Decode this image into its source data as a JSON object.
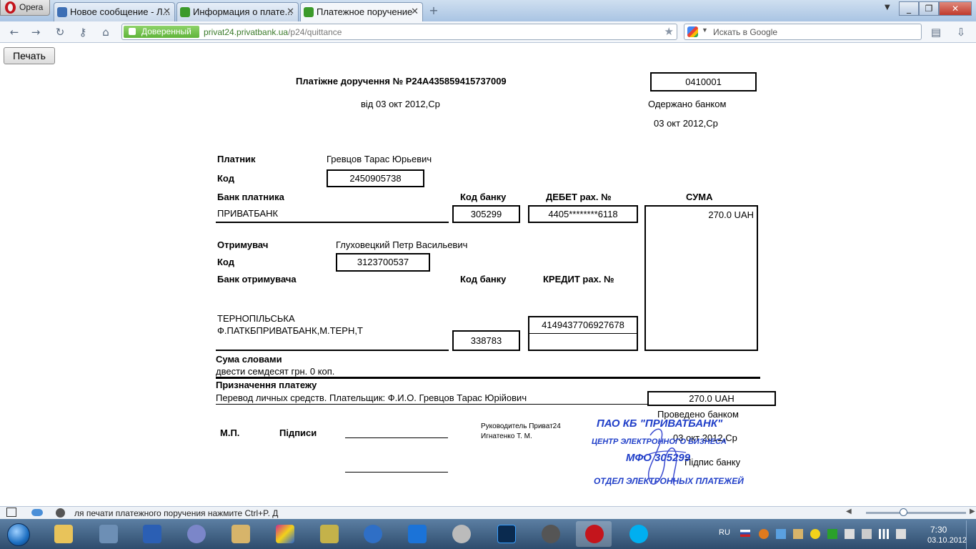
{
  "browser": {
    "app_button": "Opera",
    "tabs": [
      {
        "label": "Новое сообщение - Л...",
        "icon": "mail-icon"
      },
      {
        "label": "Информация о плате...",
        "icon": "privatbank-icon"
      },
      {
        "label": "Платежное поручение",
        "icon": "privatbank-icon"
      }
    ],
    "new_tab": "+",
    "trusted_label": "Доверенный",
    "url_host": "privat24.privatbank.ua",
    "url_path": "/p24/quittance",
    "search_placeholder": "Искать в Google",
    "window_controls": [
      "_",
      "❐",
      "✕"
    ]
  },
  "page": {
    "print_button": "Печать",
    "doc_title": "Платіжне доручення  № P24A435859415737009",
    "doc_date": "від 03 окт 2012,Ср",
    "form_code": "0410001",
    "received_label": "Одержано банком",
    "received_date": "03 окт 2012,Ср",
    "payer_label": "Платник",
    "payer_name": "Гревцов Тарас Юрьевич",
    "code_label": "Код",
    "payer_code": "2450905738",
    "payer_bank_label": "Банк платника",
    "bank_code_label": "Код банку",
    "debit_label": "ДЕБЕТ рах. №",
    "sum_label": "СУМА",
    "payer_bank": "ПРИВАТБАНК",
    "payer_bank_code": "305299",
    "debit_account": "4405********6118",
    "sum_value": "270.0 UAH",
    "recipient_label": "Отримувач",
    "recipient_name": "Глуховецкий Петр Васильевич",
    "recipient_code": "3123700537",
    "recipient_bank_label": "Банк отримувача",
    "credit_label": "КРЕДИТ рах. №",
    "recipient_bank_line1": "ТЕРНОПІЛЬСЬКА",
    "recipient_bank_line2": "Ф.ПАТКБПРИВАТБАНК,М.ТЕРН,Т",
    "credit_account": "4149437706927678",
    "recipient_bank_code": "338783",
    "sum_words_label": "Сума словами",
    "sum_words": "двести семдесят грн. 0 коп.",
    "purpose_label": "Призначення платежу",
    "purpose": "Перевод личных средств. Плательщик: Ф.И.О. Гревцов Тарас Юрійович",
    "purpose_sum": "270.0 UAH",
    "processed_label": "Проведено банком",
    "processed_date": "03 окт 2012,Ср",
    "bank_signature_label": "Підпис банку",
    "mp_label": "М.П.",
    "signatures_label": "Підписи",
    "manager_line1": "Руководитель Приват24",
    "manager_line2": "Игнатенко Т. М.",
    "stamp": {
      "line1": "ПАО КБ \"ПРИВАТБАНК\"",
      "line2": "ЦЕНТР ЭЛЕКТРОННОГО БИЗНЕСА",
      "line3": "МФО 305299",
      "line4": "ОТДЕЛ ЭЛЕКТРОННЫХ ПЛАТЕЖЕЙ",
      "color": "#1f3ec8"
    }
  },
  "status_bar": {
    "text": "ля печати платежного поручения нажмите Ctrl+P. Д"
  },
  "taskbar": {
    "apps": [
      "explorer",
      "remote",
      "word",
      "settings",
      "archive",
      "paint",
      "winamp",
      "sync",
      "teamviewer",
      "media",
      "photoshop",
      "app",
      "opera",
      "skype"
    ],
    "language": "RU",
    "time": "7:30",
    "date": "03.10.2012"
  }
}
